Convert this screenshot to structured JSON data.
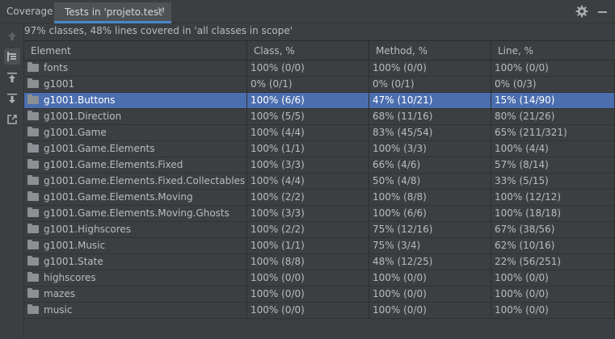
{
  "titlebar": {
    "title": "Coverage:",
    "tab_label": "Tests in 'projeto.test'",
    "close_glyph": "×",
    "gear_icon": "gear-icon",
    "minimize_icon": "minimize-icon"
  },
  "summary": "97% classes, 48% lines covered in 'all classes in scope'",
  "sidebar": {
    "buttons": [
      "up-arrow-icon",
      "flatten-packages-icon",
      "export-up-icon",
      "export-down-icon",
      "generate-report-icon"
    ]
  },
  "table": {
    "headers": [
      "Element",
      "Class, %",
      "Method, %",
      "Line, %"
    ],
    "selected_index": 2,
    "rows": [
      {
        "name": "fonts",
        "cls": "100% (0/0)",
        "method": "100% (0/0)",
        "line": "100% (0/0)"
      },
      {
        "name": "g1001",
        "cls": "0% (0/1)",
        "method": "0% (0/1)",
        "line": "0% (0/3)"
      },
      {
        "name": "g1001.Buttons",
        "cls": "100% (6/6)",
        "method": "47% (10/21)",
        "line": "15% (14/90)"
      },
      {
        "name": "g1001.Direction",
        "cls": "100% (5/5)",
        "method": "68% (11/16)",
        "line": "80% (21/26)"
      },
      {
        "name": "g1001.Game",
        "cls": "100% (4/4)",
        "method": "83% (45/54)",
        "line": "65% (211/321)"
      },
      {
        "name": "g1001.Game.Elements",
        "cls": "100% (1/1)",
        "method": "100% (3/3)",
        "line": "100% (4/4)"
      },
      {
        "name": "g1001.Game.Elements.Fixed",
        "cls": "100% (3/3)",
        "method": "66% (4/6)",
        "line": "57% (8/14)"
      },
      {
        "name": "g1001.Game.Elements.Fixed.Collectables",
        "cls": "100% (4/4)",
        "method": "50% (4/8)",
        "line": "33% (5/15)"
      },
      {
        "name": "g1001.Game.Elements.Moving",
        "cls": "100% (2/2)",
        "method": "100% (8/8)",
        "line": "100% (12/12)"
      },
      {
        "name": "g1001.Game.Elements.Moving.Ghosts",
        "cls": "100% (3/3)",
        "method": "100% (6/6)",
        "line": "100% (18/18)"
      },
      {
        "name": "g1001.Highscores",
        "cls": "100% (2/2)",
        "method": "75% (12/16)",
        "line": "67% (38/56)"
      },
      {
        "name": "g1001.Music",
        "cls": "100% (1/1)",
        "method": "75% (3/4)",
        "line": "62% (10/16)"
      },
      {
        "name": "g1001.State",
        "cls": "100% (8/8)",
        "method": "48% (12/25)",
        "line": "22% (56/251)"
      },
      {
        "name": "highscores",
        "cls": "100% (0/0)",
        "method": "100% (0/0)",
        "line": "100% (0/0)"
      },
      {
        "name": "mazes",
        "cls": "100% (0/0)",
        "method": "100% (0/0)",
        "line": "100% (0/0)"
      },
      {
        "name": "music",
        "cls": "100% (0/0)",
        "method": "100% (0/0)",
        "line": "100% (0/0)"
      }
    ]
  }
}
